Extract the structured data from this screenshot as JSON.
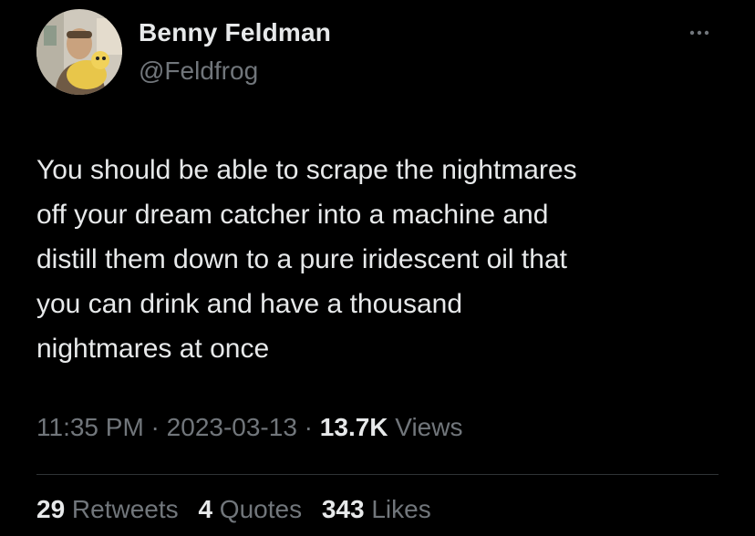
{
  "author": {
    "display_name": "Benny Feldman",
    "handle": "@Feldfrog"
  },
  "more_icon": "ellipsis-horizontal-icon",
  "tweet": {
    "lines": [
      "You should be able to scrape the nightmares",
      "off your dream catcher into a machine and",
      "distill them down to a pure iridescent oil that",
      "you can drink and have a thousand",
      "nightmares at once"
    ]
  },
  "meta": {
    "time": "11:35 PM",
    "separator": " · ",
    "date": "2023-03-13",
    "views_count": "13.7K",
    "views_label": " Views"
  },
  "stats": {
    "retweets_count": "29",
    "retweets_label": " Retweets",
    "quotes_count": "4",
    "quotes_label": " Quotes",
    "likes_count": "343",
    "likes_label": " Likes"
  },
  "colors": {
    "background": "#000000",
    "primary_text": "#e7e9ea",
    "secondary_text": "#71767b",
    "divider": "#2f3336"
  }
}
